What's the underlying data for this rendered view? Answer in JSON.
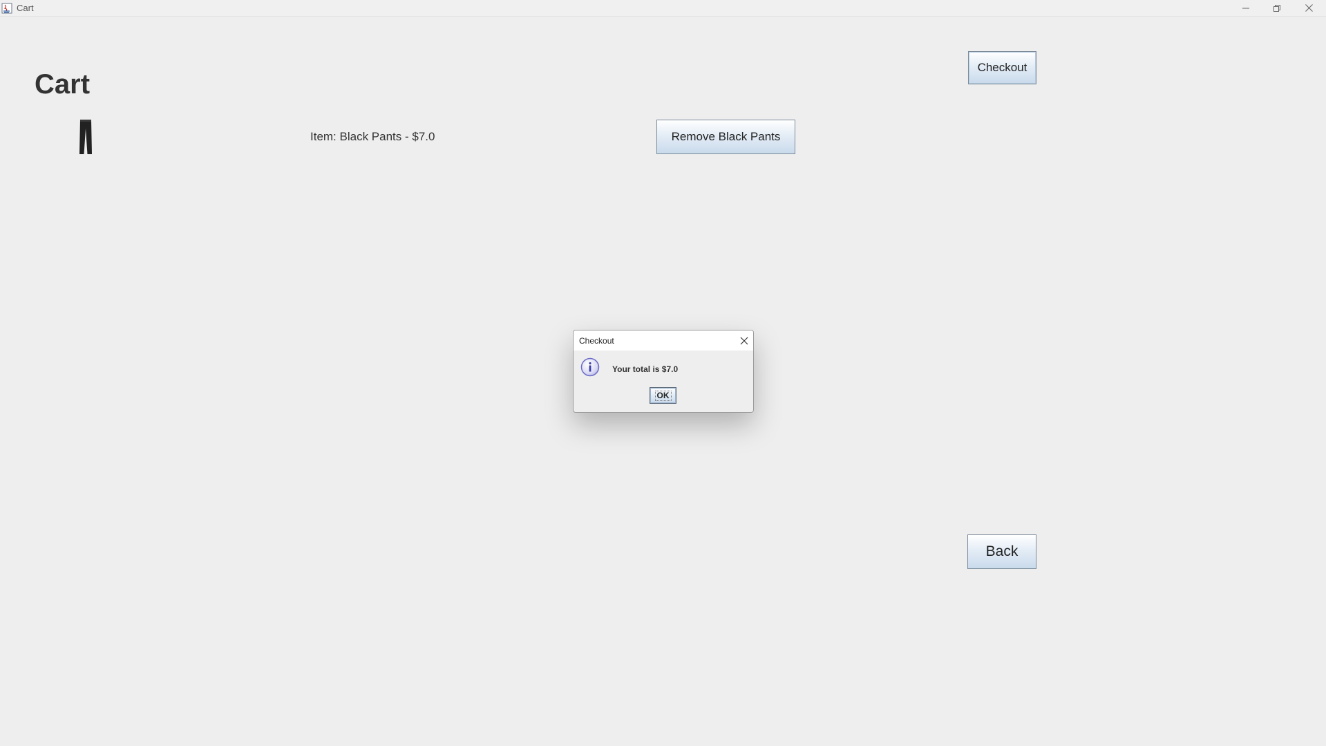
{
  "window": {
    "title": "Cart",
    "icons": {
      "app": "java-app-icon",
      "minimize": "minimize-icon",
      "maximize": "maximize-icon",
      "close": "close-icon"
    }
  },
  "cart": {
    "heading": "Cart",
    "checkout_label": "Checkout",
    "back_label": "Back",
    "items": [
      {
        "icon": "pants-icon",
        "label": "Item: Black Pants - $7.0",
        "remove_label": "Remove Black Pants"
      }
    ]
  },
  "dialog": {
    "title": "Checkout",
    "icon": "info-icon",
    "message": "Your total is $7.0",
    "ok_label": "OK"
  },
  "colors": {
    "background": "#eeeeee",
    "button_gradient_top": "#ffffff",
    "button_gradient_bottom": "#c9daec",
    "info_icon": "#6b6bc9"
  }
}
